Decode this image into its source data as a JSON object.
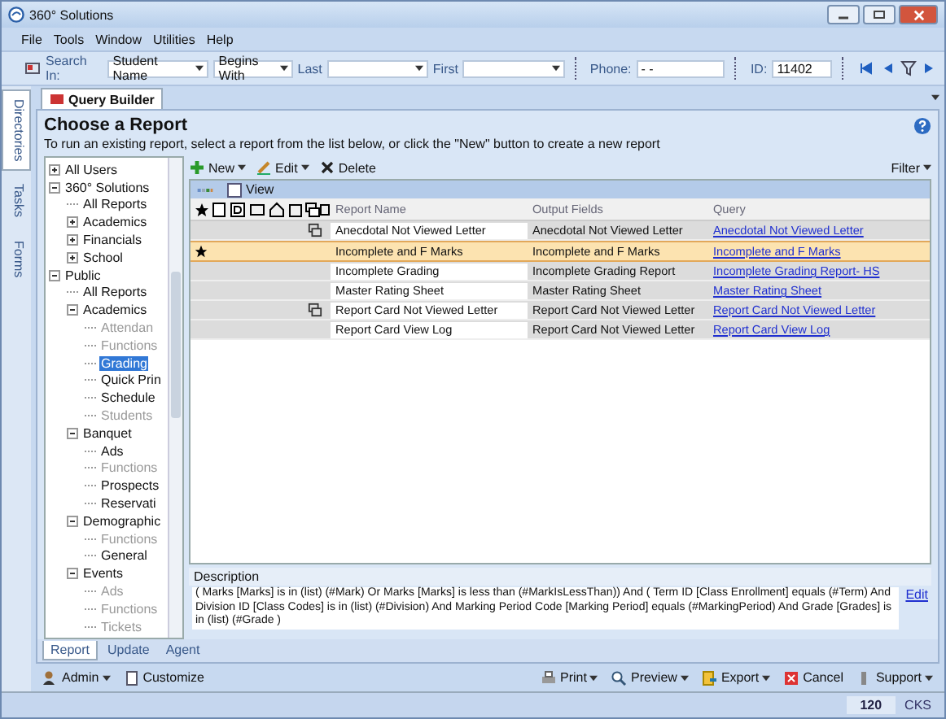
{
  "window": {
    "title": "360° Solutions"
  },
  "menu": [
    "File",
    "Tools",
    "Window",
    "Utilities",
    "Help"
  ],
  "search_bar": {
    "search_in_label": "Search In:",
    "search_in": "Student Name",
    "match": "Begins With",
    "last_label": "Last",
    "first_label": "First",
    "phone_label": "Phone:",
    "phone": "-  -",
    "id_label": "ID:",
    "id": "11402"
  },
  "side_tabs": [
    {
      "label": "Directories",
      "selected": true
    },
    {
      "label": "Tasks",
      "selected": false
    },
    {
      "label": "Forms",
      "selected": false
    }
  ],
  "document_tab": {
    "label": "Query Builder"
  },
  "header": {
    "title": "Choose a Report",
    "instructions": "To run an existing report, select a report from the list below, or click the \"New\" button to create a new report"
  },
  "tree": [
    {
      "label": "All Users",
      "expanded": false,
      "selected": false,
      "disabled": false
    },
    {
      "label": "360° Solutions",
      "expanded": true,
      "selected": false,
      "disabled": false,
      "children": [
        {
          "label": "All Reports",
          "selected": false,
          "disabled": false
        },
        {
          "label": "Academics",
          "expanded": false,
          "selected": false,
          "disabled": false
        },
        {
          "label": "Financials",
          "expanded": false,
          "selected": false,
          "disabled": false
        },
        {
          "label": "School",
          "expanded": false,
          "selected": false,
          "disabled": false
        }
      ]
    },
    {
      "label": "Public",
      "expanded": true,
      "selected": false,
      "disabled": false,
      "children": [
        {
          "label": "All Reports",
          "selected": false,
          "disabled": false
        },
        {
          "label": "Academics",
          "expanded": true,
          "selected": false,
          "disabled": false,
          "children": [
            {
              "label": "Attendan",
              "selected": false,
              "disabled": true
            },
            {
              "label": "Functions",
              "selected": false,
              "disabled": true
            },
            {
              "label": "Grading",
              "selected": true,
              "disabled": false
            },
            {
              "label": "Quick Prin",
              "selected": false,
              "disabled": false
            },
            {
              "label": "Schedule",
              "selected": false,
              "disabled": false
            },
            {
              "label": "Students",
              "selected": false,
              "disabled": true
            }
          ]
        },
        {
          "label": "Banquet",
          "expanded": true,
          "selected": false,
          "disabled": false,
          "children": [
            {
              "label": "Ads",
              "selected": false,
              "disabled": false
            },
            {
              "label": "Functions",
              "selected": false,
              "disabled": true
            },
            {
              "label": "Prospects",
              "selected": false,
              "disabled": false
            },
            {
              "label": "Reservati",
              "selected": false,
              "disabled": false
            }
          ]
        },
        {
          "label": "Demographic",
          "expanded": true,
          "selected": false,
          "disabled": false,
          "children": [
            {
              "label": "Functions",
              "selected": false,
              "disabled": true
            },
            {
              "label": "General",
              "selected": false,
              "disabled": false
            }
          ]
        },
        {
          "label": "Events",
          "expanded": true,
          "selected": false,
          "disabled": false,
          "children": [
            {
              "label": "Ads",
              "selected": false,
              "disabled": true
            },
            {
              "label": "Functions",
              "selected": false,
              "disabled": true
            },
            {
              "label": "Tickets",
              "selected": false,
              "disabled": true
            }
          ]
        }
      ]
    }
  ],
  "report_toolbar": {
    "new": "New",
    "edit": "Edit",
    "delete": "Delete",
    "filter": "Filter"
  },
  "grid": {
    "view_label": "View",
    "columns": [
      "Report Name",
      "Output Fields",
      "Query"
    ],
    "rows": [
      {
        "favorite": false,
        "linked": true,
        "name": "Anecdotal Not Viewed Letter",
        "output": "Anecdotal Not Viewed Letter",
        "query": "Anecdotal Not Viewed Letter",
        "selected": false
      },
      {
        "favorite": true,
        "linked": false,
        "name": "Incomplete and F Marks",
        "output": "Incomplete and F Marks",
        "query": "Incomplete and F Marks",
        "selected": true
      },
      {
        "favorite": false,
        "linked": false,
        "name": "Incomplete Grading",
        "output": "Incomplete Grading Report",
        "query": "Incomplete Grading Report- HS",
        "selected": false
      },
      {
        "favorite": false,
        "linked": false,
        "name": "Master Rating Sheet",
        "output": "Master Rating Sheet",
        "query": "Master Rating Sheet",
        "selected": false
      },
      {
        "favorite": false,
        "linked": true,
        "name": "Report Card Not Viewed Letter",
        "output": "Report Card Not Viewed Letter",
        "query": "Report Card Not Viewed Letter",
        "selected": false
      },
      {
        "favorite": false,
        "linked": false,
        "name": "Report Card View Log",
        "output": "Report Card Not Viewed Letter",
        "query": "Report Card View Log",
        "selected": false
      }
    ]
  },
  "description": {
    "label": "Description",
    "text": "( Marks [Marks] is in (list) (#Mark) Or Marks [Marks] is less than (#MarkIsLessThan))  And ( Term ID [Class Enrollment] equals (#Term) And Division ID [Class Codes] is in (list) (#Division) And Marking Period Code [Marking Period] equals (#MarkingPeriod) And Grade  [Grades] is in (list) (#Grade )",
    "edit": "Edit"
  },
  "bottom_tabs": [
    {
      "label": "Report",
      "selected": true
    },
    {
      "label": "Update",
      "selected": false
    },
    {
      "label": "Agent",
      "selected": false
    }
  ],
  "bottom_toolbar": {
    "admin": "Admin",
    "customize": "Customize",
    "print": "Print",
    "preview": "Preview",
    "export": "Export",
    "cancel": "Cancel",
    "support": "Support"
  },
  "status_bar": {
    "count": "120",
    "user": "CKS"
  }
}
